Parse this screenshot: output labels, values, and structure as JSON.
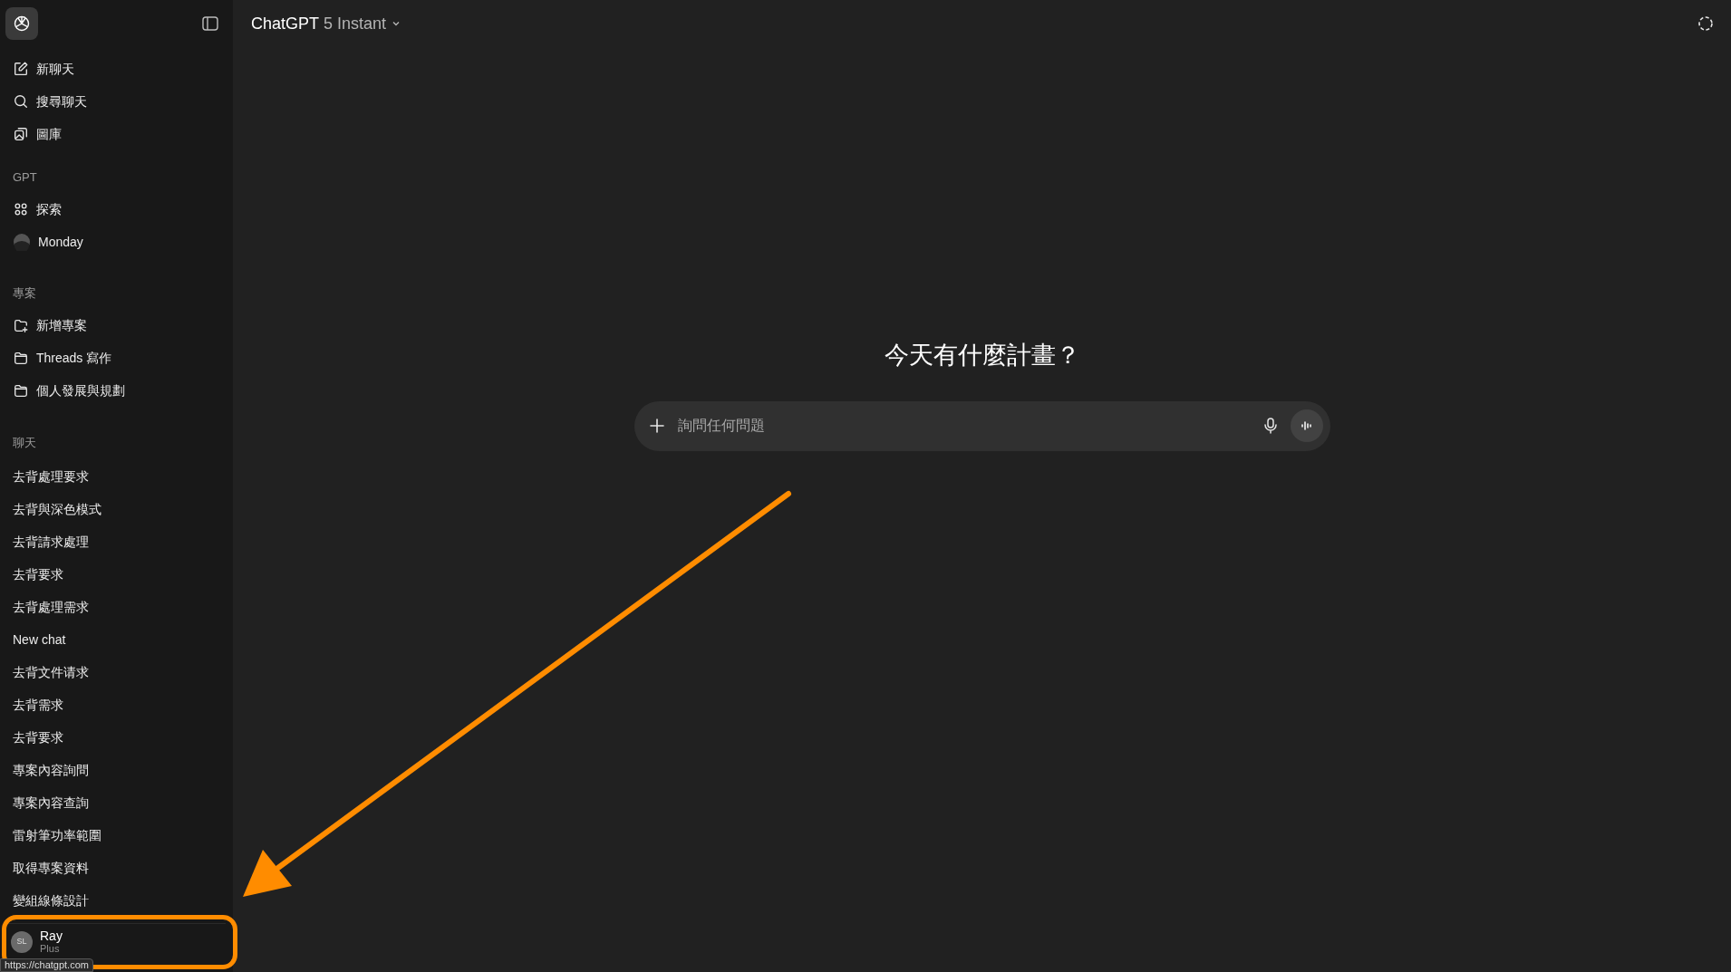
{
  "header": {
    "model_name": "ChatGPT",
    "model_version": "5 Instant"
  },
  "sidebar": {
    "top_items": [
      {
        "kind": "new",
        "label": "新聊天"
      },
      {
        "kind": "search",
        "label": "搜尋聊天"
      },
      {
        "kind": "library",
        "label": "圖庫"
      }
    ],
    "gpt_section": {
      "heading": "GPT",
      "items": [
        {
          "kind": "explore",
          "label": "探索"
        },
        {
          "kind": "gpt",
          "label": "Monday"
        }
      ]
    },
    "projects_section": {
      "heading": "專案",
      "items": [
        {
          "kind": "new_project",
          "label": "新增專案"
        },
        {
          "kind": "folder",
          "label": "Threads 寫作"
        },
        {
          "kind": "folder",
          "label": "個人發展與規劃"
        }
      ]
    },
    "chats_section": {
      "heading": "聊天",
      "items": [
        "去背處理要求",
        "去背與深色模式",
        "去背請求處理",
        "去背要求",
        "去背處理需求",
        "New chat",
        "去背文件请求",
        "去背需求",
        "去背要求",
        "專案內容詢問",
        "專案內容查詢",
        "雷射筆功率範圍",
        "取得專案資料",
        "變組線條設計"
      ]
    },
    "user": {
      "initials": "SL",
      "name": "Ray",
      "plan": "Plus"
    }
  },
  "main": {
    "heading": "今天有什麼計畫？",
    "composer": {
      "placeholder": "詢問任何問題"
    }
  },
  "status_url": "https://chatgpt.com"
}
